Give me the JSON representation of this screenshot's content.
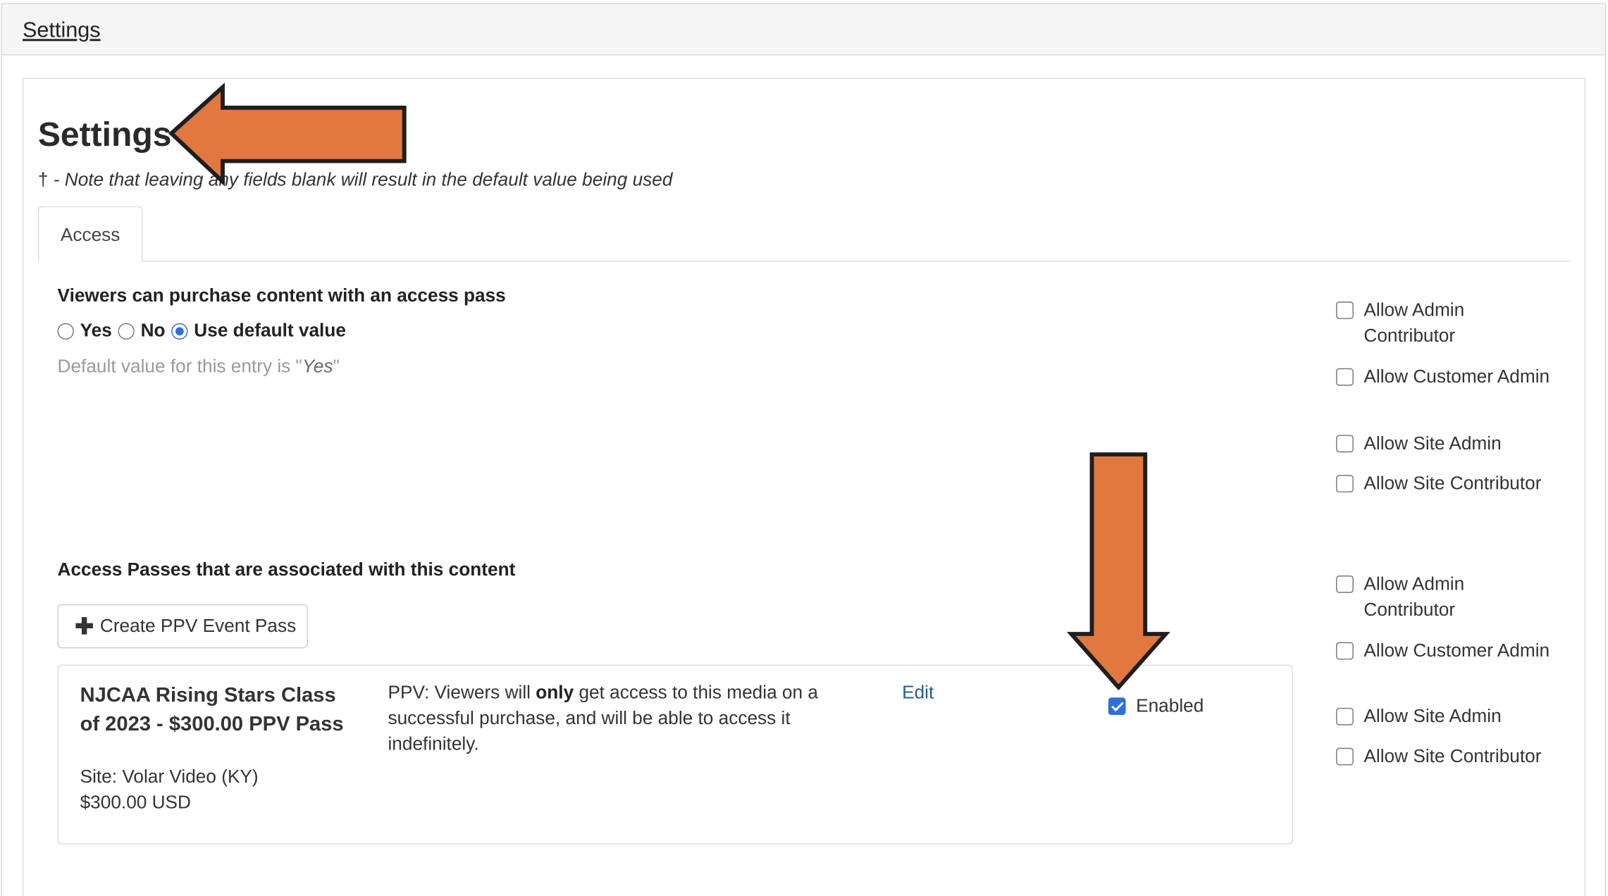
{
  "top_bar": {
    "link": "Settings"
  },
  "page": {
    "title": "Settings",
    "note_dagger": "†",
    "note_text": " - Note that leaving any fields blank will result in the default value being used"
  },
  "tabs": [
    {
      "label": "Access",
      "active": true
    }
  ],
  "purchase_section": {
    "label": "Viewers can purchase content with an access pass",
    "options": [
      {
        "label": "Yes",
        "checked": false
      },
      {
        "label": "No",
        "checked": false
      },
      {
        "label": "Use default value",
        "checked": true
      }
    ],
    "hint_prefix": "Default value for this entry is \"",
    "hint_value": "Yes",
    "hint_suffix": "\"",
    "permissions": [
      {
        "label": "Allow Admin Contributor",
        "checked": false
      },
      {
        "label": "Allow Customer Admin",
        "checked": false
      },
      {
        "label": "Allow Site Admin",
        "checked": false
      },
      {
        "label": "Allow Site Contributor",
        "checked": false
      }
    ]
  },
  "passes_section": {
    "label": "Access Passes that are associated with this content",
    "create_button": "Create PPV Event Pass",
    "permissions": [
      {
        "label": "Allow Admin Contributor",
        "checked": false
      },
      {
        "label": "Allow Customer Admin",
        "checked": false
      },
      {
        "label": "Allow Site Admin",
        "checked": false
      },
      {
        "label": "Allow Site Contributor",
        "checked": false
      }
    ],
    "pass": {
      "name": "NJCAA Rising Stars Class of 2023 - $300.00 PPV Pass",
      "site": "Site: Volar Video (KY)",
      "price": "$300.00 USD",
      "desc_prefix": "PPV: Viewers will ",
      "desc_bold": "only",
      "desc_suffix": " get access to this media on a successful purchase, and will be able to access it indefinitely.",
      "edit_label": "Edit",
      "enabled_label": "Enabled",
      "enabled": true
    }
  },
  "annotations": {
    "arrow_color": "#e07840",
    "arrow_outline": "#1e1e1e"
  }
}
